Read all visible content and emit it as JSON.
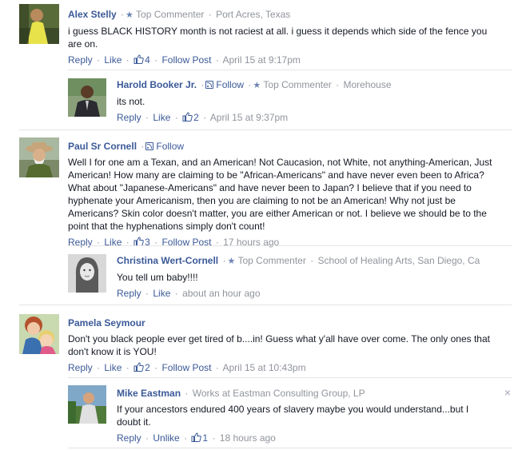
{
  "labels": {
    "reply": "Reply",
    "like": "Like",
    "unlike": "Unlike",
    "follow": "Follow",
    "follow_post": "Follow Post",
    "top_commenter": "Top Commenter",
    "dot": "·"
  },
  "comments": [
    {
      "author": "Alex Stelly",
      "badge": "Top Commenter",
      "affiliation": "Port Acres, Texas",
      "text": "i guess BLACK HISTORY month is not raciest at all. i guess it depends which side of the fence you are on.",
      "likes": "4",
      "time": "April 15 at 9:17pm"
    },
    {
      "author": "Harold Booker Jr.",
      "badge": "Top Commenter",
      "affiliation": "Morehouse",
      "text": "its not.",
      "likes": "2",
      "time": "April 15 at 9:37pm"
    },
    {
      "author": "Paul Sr Cornell",
      "text": "Well I for one am a Texan, and an American! Not Caucasion, not White, not anything-American, Just American! How many are claiming to be \"African-Americans\" and have never even been to Africa? What about \"Japanese-Americans\" and have never been to Japan? I believe that if you need to hyphenate your Americanism, then you are claiming to not be an American! Why not just be Americans? Skin color doesn't matter, you are either American or not. I believe we should be to the point that the hyphenations simply don't count!",
      "likes": "3",
      "time": "17 hours ago"
    },
    {
      "author": "Christina Wert-Cornell",
      "badge": "Top Commenter",
      "affiliation": "School of Healing Arts, San Diego, Ca",
      "text": "You tell um baby!!!!",
      "time": "about an hour ago"
    },
    {
      "author": "Pamela Seymour",
      "text": "Don't you black people ever get tired of b....in! Guess what y'all have over come. The only ones that don't know it is YOU!",
      "likes": "2",
      "time": "April 15 at 10:43pm"
    },
    {
      "author": "Mike Eastman",
      "affiliation": "Works at Eastman Consulting Group, LP",
      "text": "If your ancestors endured 400 years of slavery maybe you would understand...but I doubt it.",
      "likes": "1",
      "time": "18 hours ago"
    }
  ],
  "close_glyph": "×",
  "colors": {
    "link": "#3b5998",
    "meta": "#90949c",
    "divider": "#e5e5e5"
  },
  "icons": [
    "like-thumb-icon",
    "star-icon",
    "rss-follow-icon",
    "close-icon"
  ]
}
